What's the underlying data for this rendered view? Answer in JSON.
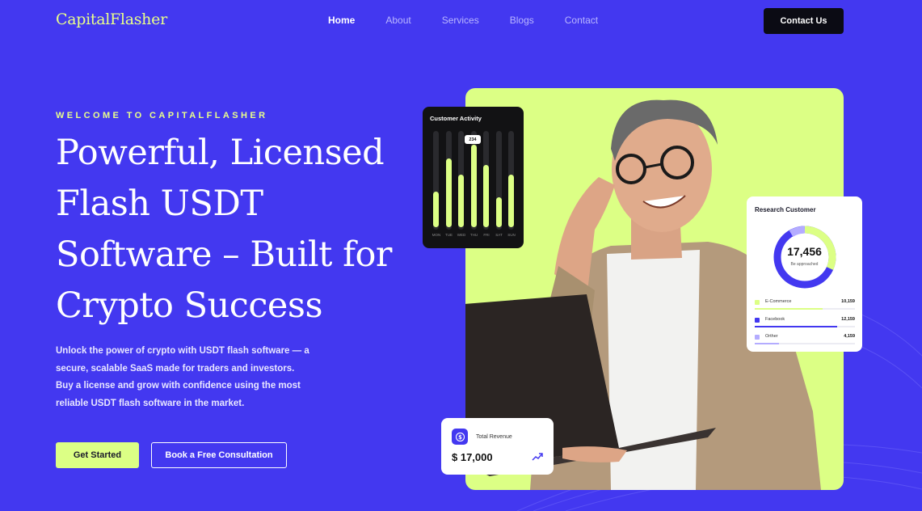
{
  "nav": {
    "logo": "CapitalFlasher",
    "items": [
      {
        "label": "Home",
        "active": true
      },
      {
        "label": "About",
        "active": false
      },
      {
        "label": "Services",
        "active": false
      },
      {
        "label": "Blogs",
        "active": false
      },
      {
        "label": "Contact",
        "active": false
      }
    ],
    "cta_label": "Contact Us"
  },
  "hero": {
    "eyebrow": "WELCOME TO CAPITALFLASHER",
    "headline_lines": [
      "Powerful, Licensed",
      "Flash USDT",
      "Software – Built for",
      "Crypto Success"
    ],
    "subtext": "Unlock the power of crypto with USDT flash software — a secure, scalable SaaS made for traders and investors. Buy a license and grow with confidence using the most reliable USDT flash software in the market.",
    "primary_button": "Get Started",
    "secondary_button": "Book a Free Consultation"
  },
  "activity_card": {
    "title": "Customer Activity",
    "tooltip": "234",
    "days": [
      "MON",
      "TUE",
      "WED",
      "THU",
      "FRI",
      "SAT",
      "SUN"
    ],
    "levels": [
      0.36,
      0.7,
      0.53,
      0.84,
      0.63,
      0.3,
      0.53
    ]
  },
  "research_card": {
    "title": "Research Customer",
    "total": "17,456",
    "total_sub": "Be approached",
    "rows": [
      {
        "name": "E-Commerce",
        "value": "10,159",
        "color": "#dcff85",
        "share": 0.68
      },
      {
        "name": "Facebook",
        "value": "12,159",
        "color": "#4338f0",
        "share": 0.82
      },
      {
        "name": "Orther",
        "value": "4,159",
        "color": "#b4acff",
        "share": 0.24
      }
    ]
  },
  "revenue_card": {
    "label": "Total Revenue",
    "value": "$ 17,000",
    "icon": "dollar-icon",
    "trend_icon": "trend-up-icon"
  },
  "colors": {
    "background": "#4338f0",
    "accent": "#dcff85",
    "dark": "#0b0b14"
  }
}
